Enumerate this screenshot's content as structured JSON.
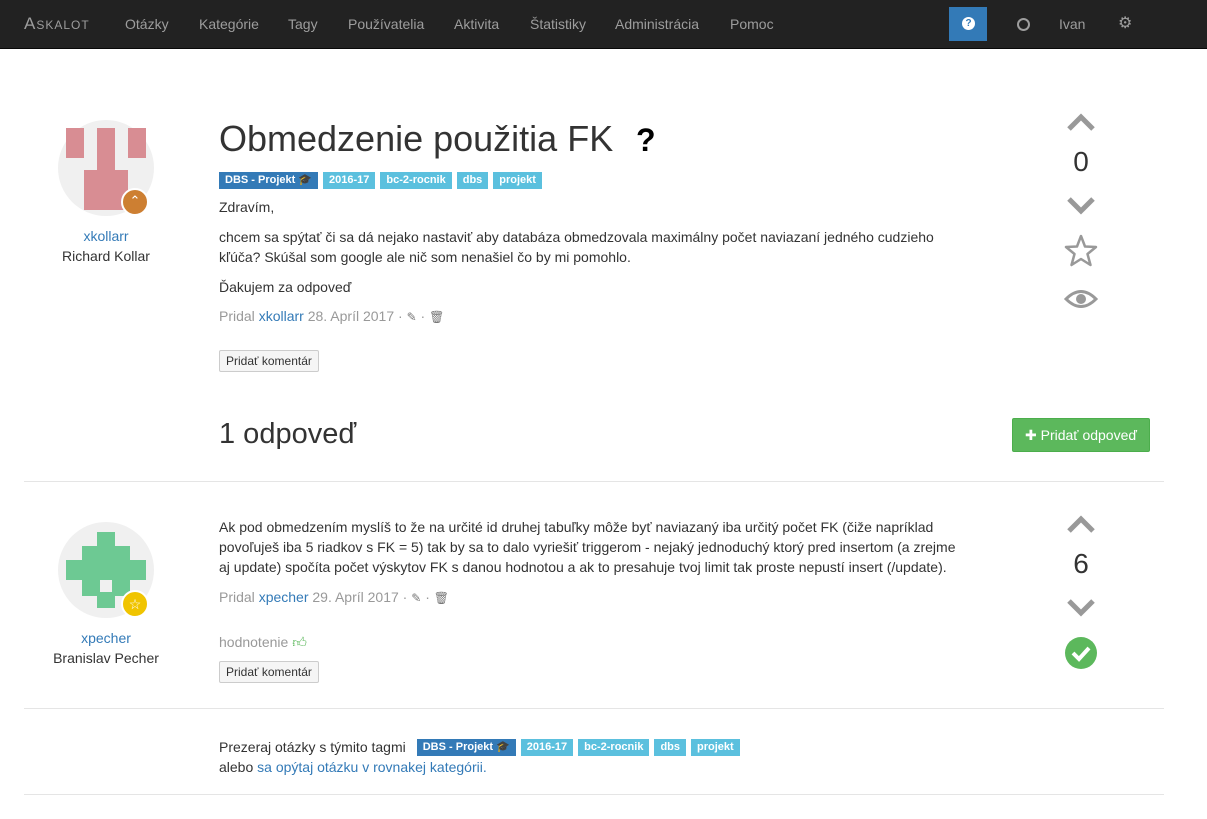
{
  "navbar": {
    "brand": "Askalot",
    "items": [
      "Otázky",
      "Kategórie",
      "Tagy",
      "Používatelia",
      "Aktivita",
      "Štatistiky",
      "Administrácia",
      "Pomoc"
    ],
    "help_icon": "question-circle-icon",
    "user": "Ivan",
    "settings_icon": "gear-icon"
  },
  "question": {
    "title": "Obmedzenie použitia FK",
    "title_icon": "?",
    "tags": [
      "DBS - Projekt 🎓",
      "2016-17",
      "bc-2-rocnik",
      "dbs",
      "projekt"
    ],
    "paragraphs": [
      "Zdravím,",
      "chcem sa spýtať či sa dá nejako nastaviť aby databáza obmedzovala maximálny počet naviazaní jedného cudzieho kľúča? Skúšal som google ale nič som nenašiel čo by mi pomohlo.",
      "Ďakujem za odpoveď"
    ],
    "meta_prefix": "Pridal",
    "author_login": "xkollarr",
    "date": "28. Apríl 2017",
    "add_comment": "Pridať komentár",
    "votes": "0",
    "author_name": "Richard Kollar"
  },
  "answers_heading": "1 odpoveď",
  "add_answer_button": "Pridať odpoveď",
  "answer": {
    "text": "Ak pod obmedzením myslíš to že na určité id druhej tabuľky môže byť naviazaný iba určitý počet FK (čiže napríklad povoľuješ iba 5 riadkov s FK = 5) tak by sa to dalo vyriešiť triggerom - nejaký jednoduchý ktorý pred insertom (a zrejme aj update) spočíta počet výskytov FK s danou hodnotou a ak to presahuje tvoj limit tak proste nepustí insert (/update).",
    "meta_prefix": "Pridal",
    "author_login": "xpecher",
    "date": "29. Apríl 2017",
    "rating_label": "hodnotenie",
    "add_comment": "Pridať komentár",
    "votes": "6",
    "author_name": "Branislav Pecher"
  },
  "browse": {
    "prefix": "Prezeraj otázky s týmito tagmi",
    "tags": [
      "DBS - Projekt 🎓",
      "2016-17",
      "bc-2-rocnik",
      "dbs",
      "projekt"
    ],
    "or": "alebo",
    "link": "sa opýtaj otázku v rovnakej kategórii."
  },
  "colors": {
    "accent": "#337ab7",
    "tag": "#5bc0de",
    "success": "#5cb85c",
    "bronze": "#cd7f32",
    "gold": "#f0c400"
  }
}
